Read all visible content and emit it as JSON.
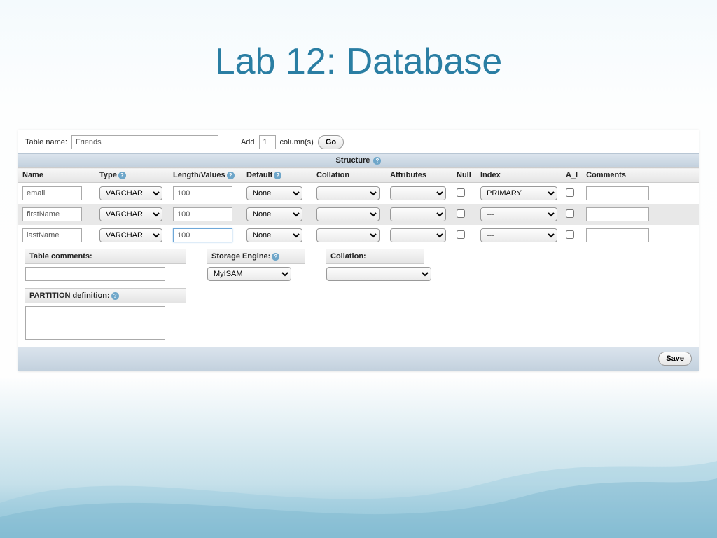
{
  "slide": {
    "title": "Lab 12: Database"
  },
  "form": {
    "table_name_label": "Table name:",
    "table_name_value": "Friends",
    "add_label": "Add",
    "add_count": "1",
    "columns_label": "column(s)",
    "go_button": "Go",
    "structure_heading": "Structure",
    "headers": {
      "name": "Name",
      "type": "Type",
      "length": "Length/Values",
      "default": "Default",
      "collation": "Collation",
      "attributes": "Attributes",
      "null": "Null",
      "index": "Index",
      "ai": "A_I",
      "comments": "Comments"
    },
    "rows": [
      {
        "name": "email",
        "type": "VARCHAR",
        "length": "100",
        "default": "None",
        "index": "PRIMARY",
        "focused": false,
        "alt": false
      },
      {
        "name": "firstName",
        "type": "VARCHAR",
        "length": "100",
        "default": "None",
        "index": "---",
        "focused": false,
        "alt": true
      },
      {
        "name": "lastName",
        "type": "VARCHAR",
        "length": "100",
        "default": "None",
        "index": "---",
        "focused": true,
        "alt": false
      }
    ],
    "meta": {
      "table_comments_label": "Table comments:",
      "storage_engine_label": "Storage Engine:",
      "storage_engine_value": "MyISAM",
      "collation_label": "Collation:",
      "partition_label": "PARTITION definition:"
    },
    "save_button": "Save"
  }
}
